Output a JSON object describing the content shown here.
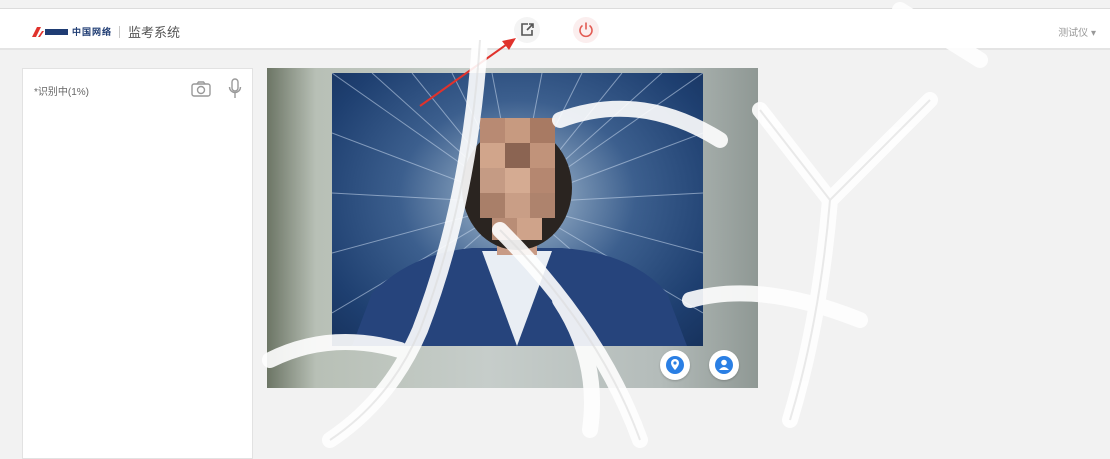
{
  "header": {
    "brand_text": "中国网络",
    "title": "监考系统",
    "user_menu": "测试仪 ▾"
  },
  "toolbar": {
    "share_icon": "share-screen-icon",
    "power_icon": "power-icon"
  },
  "left_panel": {
    "label": "*识别中(1%)",
    "camera_icon": "camera-icon",
    "mic_icon": "microphone-icon"
  },
  "video": {
    "locate_icon": "location-icon",
    "person_icon": "person-icon"
  },
  "colors": {
    "accent_blue": "#2a7fe4",
    "power_red": "#e25a52",
    "logo_red": "#e0322c"
  }
}
